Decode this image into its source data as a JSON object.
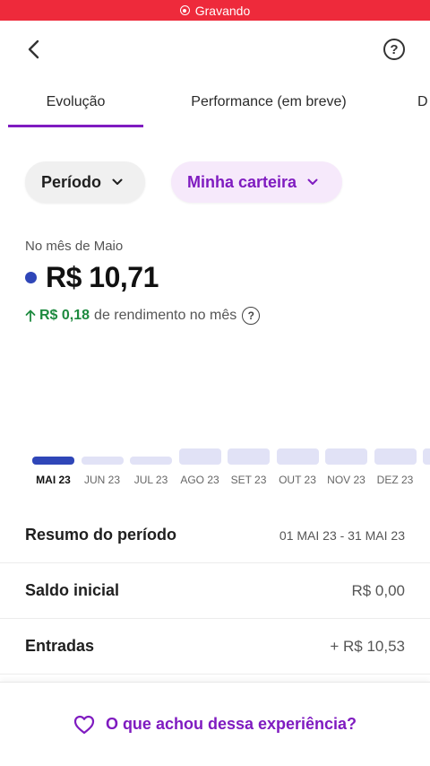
{
  "recording": {
    "label": "Gravando",
    "color": "#ee2a3b"
  },
  "nav": {
    "back_icon": "chevron-left-icon",
    "help_icon": "help-circle-icon",
    "help_glyph": "?"
  },
  "tabs": [
    {
      "label": "Evolução",
      "active": true
    },
    {
      "label": "Performance (em breve)",
      "active": false
    },
    {
      "label": "D",
      "active": false
    }
  ],
  "filters": {
    "period_label": "Período",
    "wallet_label": "Minha carteira"
  },
  "summary": {
    "month_label": "No mês de Maio",
    "balance": "R$ 10,71",
    "yield_value": "R$ 0,18",
    "yield_text": "de rendimento no mês",
    "yield_help_glyph": "?"
  },
  "chart_data": {
    "type": "bar",
    "categories": [
      "MAI 23",
      "JUN 23",
      "JUL 23",
      "AGO 23",
      "SET 23",
      "OUT 23",
      "NOV 23",
      "DEZ 23"
    ],
    "selected_index": 0,
    "series": [
      {
        "values": [
          1,
          1,
          1,
          2,
          2,
          2,
          2,
          2
        ]
      }
    ],
    "colors": {
      "selected": "#2f46b8",
      "default": "#e1e2f6"
    }
  },
  "rows": [
    {
      "label": "Resumo do período",
      "value": "01 MAI 23 - 31 MAI 23"
    },
    {
      "label": "Saldo inicial",
      "value": "R$ 0,00"
    },
    {
      "label": "Entradas",
      "value": "+ R$ 10,53"
    }
  ],
  "feedback": {
    "label": "O que achou dessa experiência?",
    "icon": "heart-icon"
  },
  "colors": {
    "accent": "#7f1bc0",
    "positive": "#1d8a3f",
    "balance_dot": "#2f46b8"
  }
}
